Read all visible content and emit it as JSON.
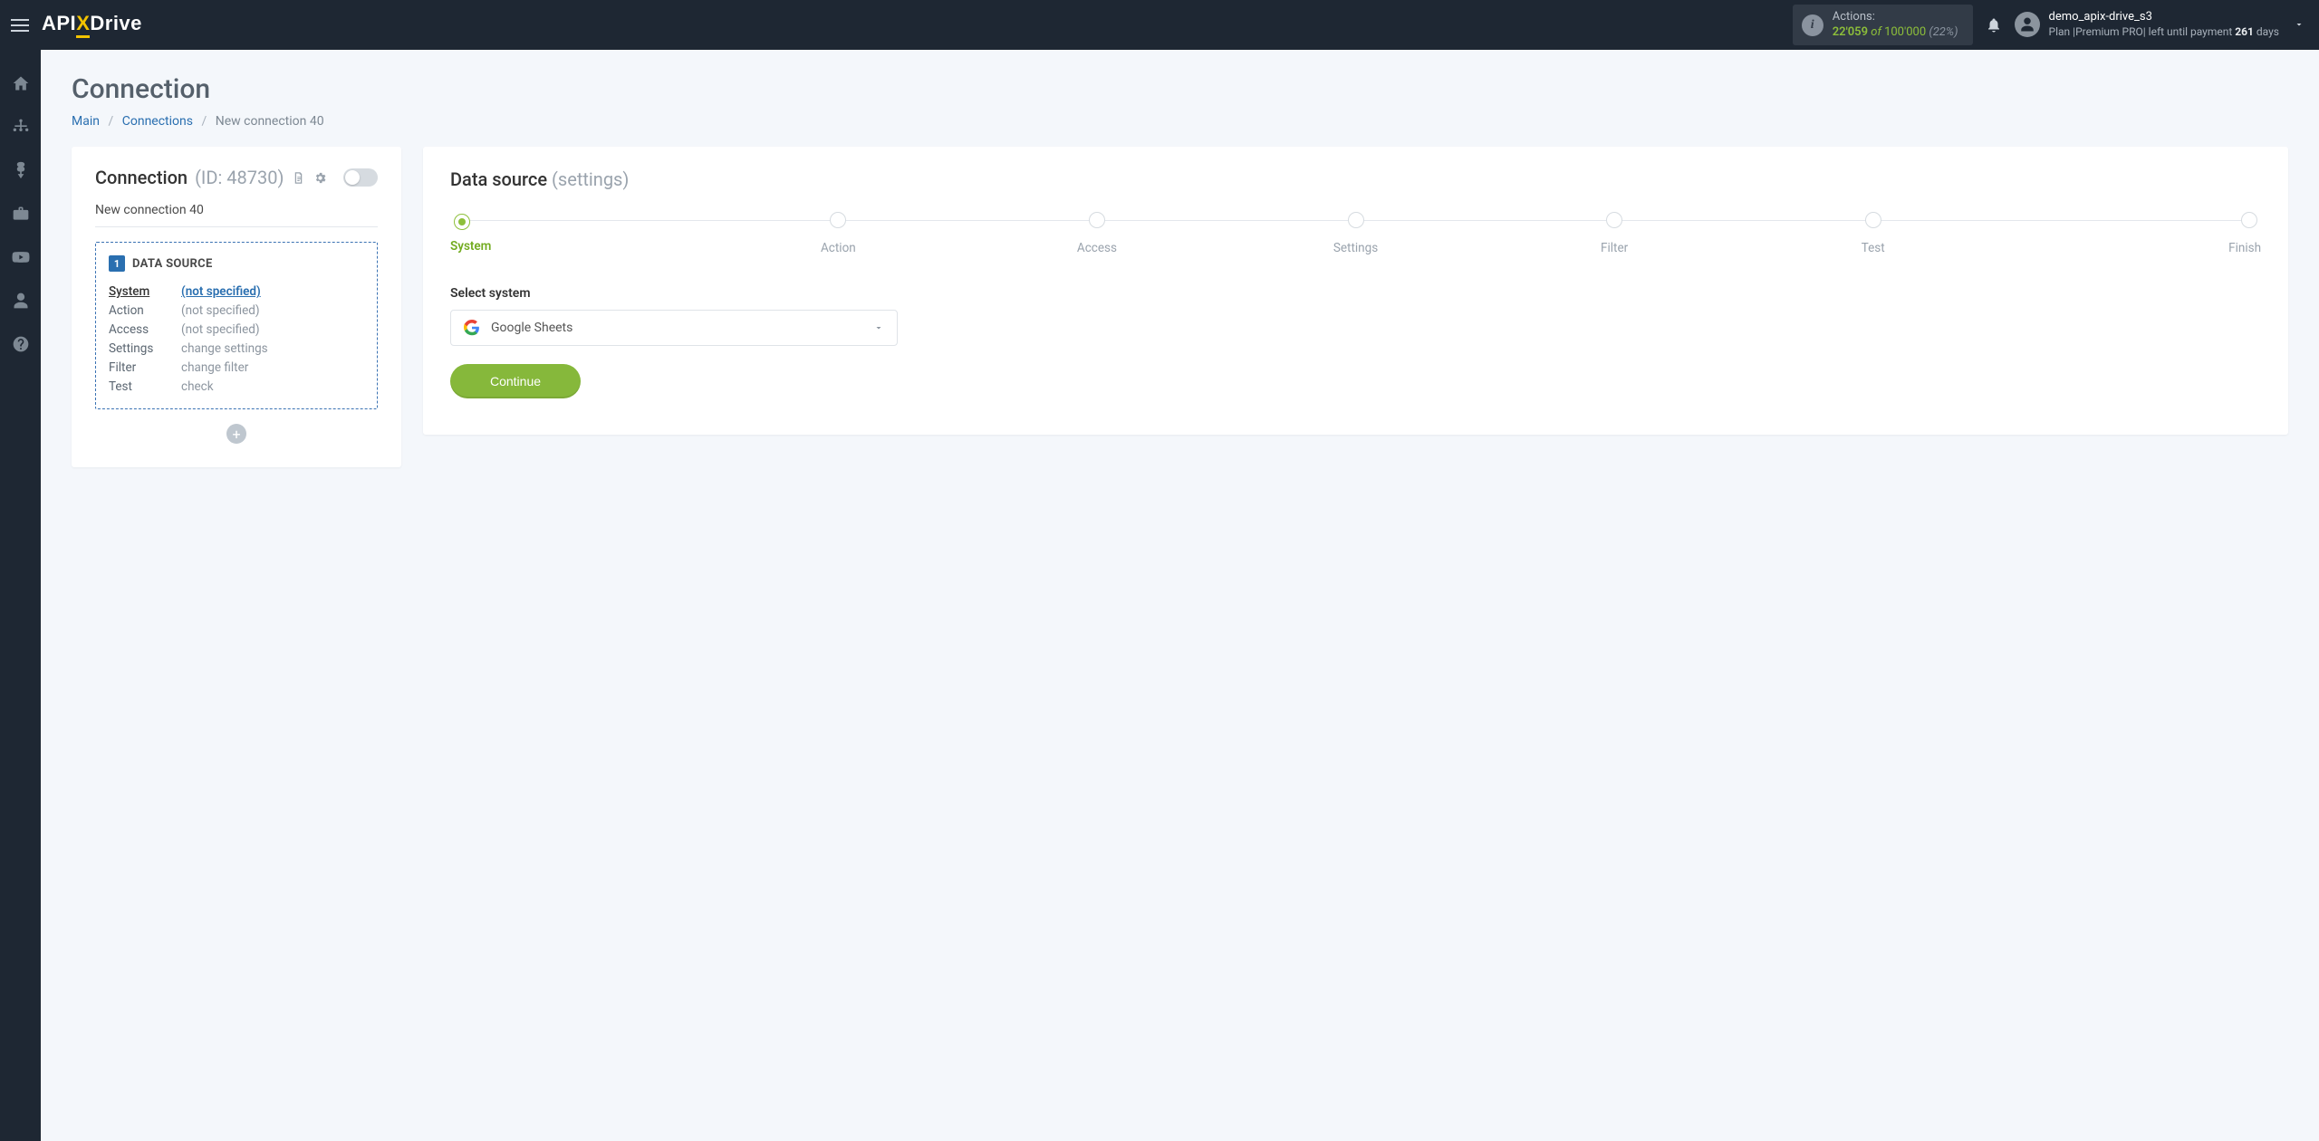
{
  "header": {
    "actions": {
      "label": "Actions:",
      "used": "22'059",
      "of": "of",
      "total": "100'000",
      "percent": "(22%)"
    },
    "user": {
      "name": "demo_apix-drive_s3",
      "plan_prefix": "Plan |",
      "plan_name": "Premium PRO",
      "plan_mid": "| left until payment ",
      "plan_days": "261",
      "plan_suffix": " days"
    }
  },
  "page": {
    "title": "Connection",
    "breadcrumb": {
      "main": "Main",
      "connections": "Connections",
      "current": "New connection 40"
    }
  },
  "left_card": {
    "title": "Connection",
    "id_label": "(ID: 48730)",
    "connection_name": "New connection 40",
    "datasource_box": {
      "num": "1",
      "title": "DATA SOURCE",
      "rows": [
        {
          "label": "System",
          "value": "(not specified)",
          "label_link": true,
          "value_link": true
        },
        {
          "label": "Action",
          "value": "(not specified)",
          "label_link": false,
          "value_link": false
        },
        {
          "label": "Access",
          "value": "(not specified)",
          "label_link": false,
          "value_link": false
        },
        {
          "label": "Settings",
          "value": "change settings",
          "label_link": false,
          "value_link": false
        },
        {
          "label": "Filter",
          "value": "change filter",
          "label_link": false,
          "value_link": false
        },
        {
          "label": "Test",
          "value": "check",
          "label_link": false,
          "value_link": false
        }
      ]
    }
  },
  "right_card": {
    "title": "Data source",
    "subtitle": "(settings)",
    "steps": [
      "System",
      "Action",
      "Access",
      "Settings",
      "Filter",
      "Test",
      "Finish"
    ],
    "active_step": 0,
    "field_label": "Select system",
    "selected_system": "Google Sheets",
    "continue": "Continue"
  }
}
